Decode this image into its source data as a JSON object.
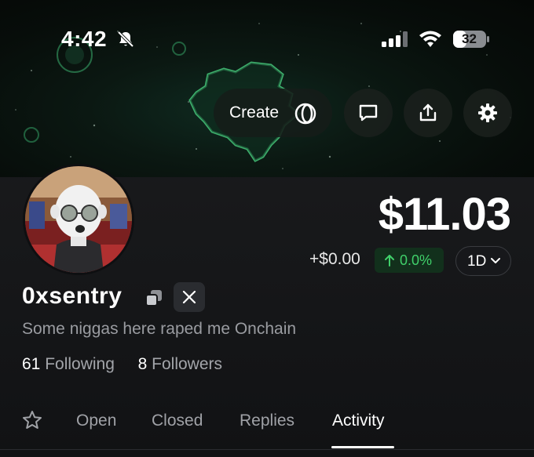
{
  "status_bar": {
    "time": "4:42",
    "battery": "32"
  },
  "header": {
    "create_label": "Create"
  },
  "portfolio": {
    "balance": "$11.03",
    "change_abs": "+$0.00",
    "change_pct": "0.0%",
    "range": "1D"
  },
  "profile": {
    "username": "0xsentry",
    "bio": "Some niggas here raped me Onchain",
    "following_count": "61",
    "following_label": "Following",
    "followers_count": "8",
    "followers_label": "Followers"
  },
  "tabs": [
    {
      "label": "Open"
    },
    {
      "label": "Closed"
    },
    {
      "label": "Replies"
    },
    {
      "label": "Activity",
      "active": true
    }
  ],
  "colors": {
    "accent_green": "#40d06a",
    "positive_bg": "#12301c",
    "background": "#141517"
  }
}
